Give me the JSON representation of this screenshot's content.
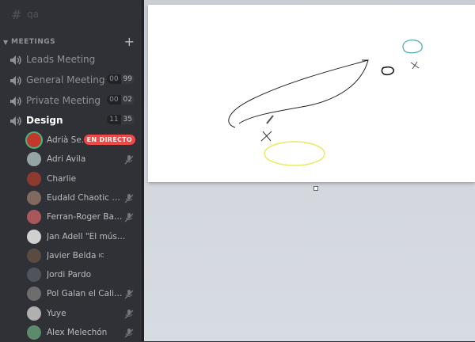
{
  "sidebar": {
    "top_channel": {
      "name": "qa",
      "icon": "hash-icon"
    },
    "category": {
      "label": "MEETINGS",
      "add_icon": "plus-icon"
    },
    "voice_channels": [
      {
        "name": "Leads Meeting",
        "icon": "speaker-icon"
      },
      {
        "name": "General Meeting",
        "icon": "speaker-icon",
        "count": "00",
        "limit": "99"
      },
      {
        "name": "Private Meeting",
        "icon": "speaker-icon",
        "count": "00",
        "limit": "02"
      },
      {
        "name": "Design",
        "icon": "speaker-icon",
        "count": "11",
        "limit": "35",
        "active": true
      }
    ],
    "users": [
      {
        "name": "Adrià Se...",
        "badge": "EN DIRECTO",
        "avatar_color": "#c0392b",
        "muted": false
      },
      {
        "name": "Adri Avila",
        "avatar_color": "#95a5a6",
        "muted": true
      },
      {
        "name": "Charlie",
        "avatar_color": "#8e3b2f",
        "muted": false
      },
      {
        "name": "Eudald Chaotic Neu...",
        "avatar_color": "#7f6a5d",
        "muted": true
      },
      {
        "name": "Ferran-Roger Basart",
        "avatar_color": "#a8585a",
        "muted": true
      },
      {
        "name": "Jan Adell \"El músicas\"",
        "avatar_color": "#d0d0d0",
        "muted": false
      },
      {
        "name": "Javier Belda",
        "tag": "IC",
        "avatar_color": "#5a4a42",
        "muted": false
      },
      {
        "name": "Jordi Pardo",
        "avatar_color": "#4f545c",
        "muted": false
      },
      {
        "name": "Pol Galan el Caliente",
        "avatar_color": "#6d6d6d",
        "muted": true
      },
      {
        "name": "Yuye",
        "avatar_color": "#b0b0b0",
        "muted": true
      },
      {
        "name": "Àlex Melechón",
        "avatar_color": "#5d8a6a",
        "muted": true
      }
    ]
  },
  "colors": {
    "live": "#f04747",
    "sidebar_bg": "#2f3136",
    "canvas_bg": "#ffffff"
  }
}
